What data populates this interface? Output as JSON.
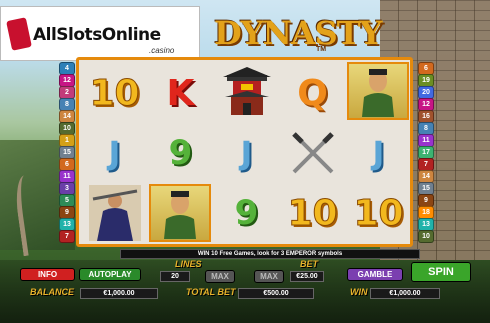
{
  "logo": {
    "name": "AllSlotsOnline",
    "suffix": ".casino"
  },
  "game": {
    "title": "DYNASTY",
    "tm": "TM"
  },
  "paylines_left": [
    4,
    12,
    2,
    8,
    14,
    10,
    1,
    15,
    6,
    11,
    3,
    5,
    9,
    13,
    7
  ],
  "paylines_right": [
    6,
    19,
    20,
    12,
    16,
    8,
    11,
    17,
    7,
    14,
    15,
    9,
    18,
    13,
    10
  ],
  "reels": {
    "row1": [
      "10",
      "K",
      "temple",
      "Q",
      "emperor"
    ],
    "row2": [
      "J",
      "9",
      "J",
      "swords",
      "J"
    ],
    "row3": [
      "warrior",
      "emperor",
      "9",
      "10",
      "10"
    ]
  },
  "message": "WIN 10 Free Games, look for 3 EMPEROR symbols",
  "controls": {
    "info": "INFO",
    "autoplay": "AUTOPLAY",
    "lines_label": "LINES",
    "lines_value": "20",
    "max1": "MAX",
    "max2": "MAX",
    "bet_label": "BET",
    "bet_value": "€25.00",
    "gamble": "GAMBLE",
    "spin": "SPIN",
    "balance_label": "BALANCE",
    "balance_value": "€1,000.00",
    "totalbet_label": "TOTAL BET",
    "totalbet_value": "€500.00",
    "win_label": "WIN",
    "win_value": "€1,000.00"
  },
  "colors": {
    "accent": "#e58a0c",
    "title": "#e3a21a",
    "spin": "#3aa52a",
    "gamble": "#7b3fb0",
    "info": "#d02020"
  }
}
